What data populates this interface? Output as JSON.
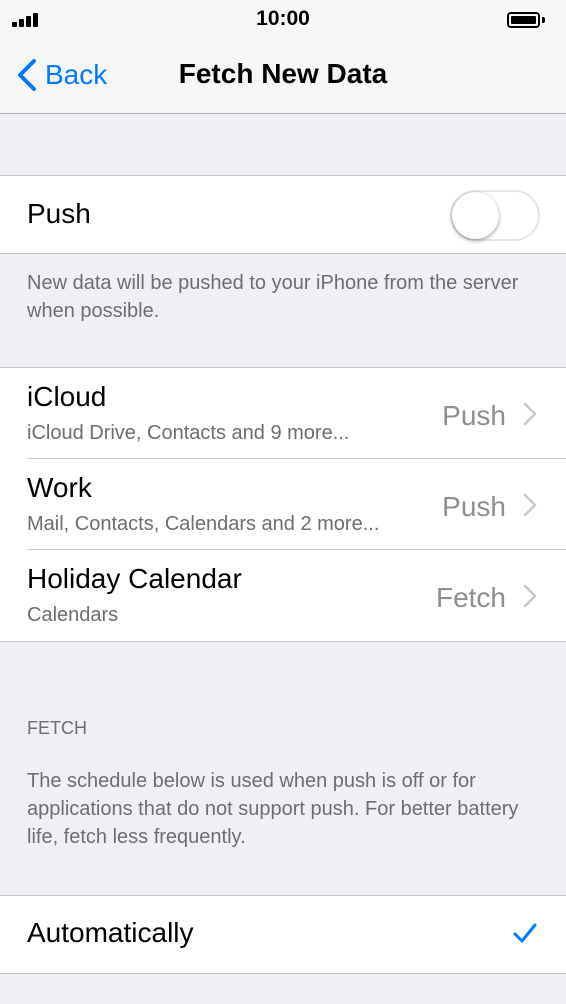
{
  "status_bar": {
    "time": "10:00",
    "signal_icon": "signal-bars-icon",
    "battery_icon": "battery-icon"
  },
  "nav": {
    "back_label": "Back",
    "title": "Fetch New Data"
  },
  "push_section": {
    "label": "Push",
    "toggle_on": false,
    "footer": "New data will be pushed to your iPhone from the server when possible."
  },
  "accounts": [
    {
      "title": "iCloud",
      "subtitle": "iCloud Drive, Contacts and 9 more...",
      "value": "Push"
    },
    {
      "title": "Work",
      "subtitle": "Mail, Contacts, Calendars and 2 more...",
      "value": "Push"
    },
    {
      "title": "Holiday Calendar",
      "subtitle": "Calendars",
      "value": "Fetch"
    }
  ],
  "fetch_section": {
    "header": "FETCH",
    "description": "The schedule below is used when push is off or for applications that do not support push. For better battery life, fetch less frequently.",
    "options": [
      {
        "label": "Automatically",
        "selected": true
      }
    ]
  },
  "colors": {
    "accent": "#007aff",
    "background": "#efeff4",
    "secondary_text": "#6d6d72",
    "value_text": "#8e8e93",
    "separator": "#c8c7cc"
  }
}
